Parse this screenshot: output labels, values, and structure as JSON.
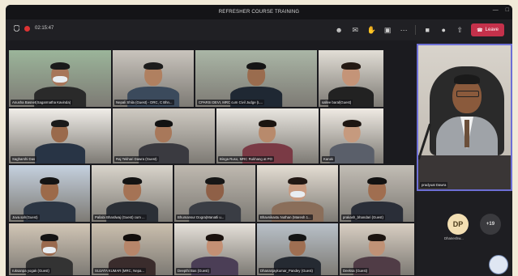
{
  "window": {
    "title": "REFRESHER COURSE TRAINING"
  },
  "toolbar": {
    "timer": "02:15:47",
    "leave_label": "Leave"
  },
  "tiles": [
    {
      "name": "Anusha Basnet(Sagarmatha Kavinda)"
    },
    {
      "name": "Nepali Shila (Guest) - DRC, C Bhn..."
    },
    {
      "name": "CPARSI DEVI, MRC cum Civil Judge (L..."
    },
    {
      "name": "sallee baral(Guest)"
    },
    {
      "name": "Sagharshi Das"
    },
    {
      "name": "Raj Tekhari Dawra (Guest)"
    },
    {
      "name": "Binga Ruso, MRC Rukhang at PO"
    },
    {
      "name": "Karuki"
    },
    {
      "name": "Juva.sah(Guest)"
    },
    {
      "name": "Pallabi Bhardwaj (Guest) cum ..."
    },
    {
      "name": "Bhumansur Dogra(Manatli u..."
    },
    {
      "name": "Bhavnikastu Nuthan (Maresh 1..."
    },
    {
      "name": "prakash_bhandari (Guest)"
    },
    {
      "name": "ruksanpa yogak (Guest)"
    },
    {
      "name": "SUJATA KUMAR (MRC, Nepa..."
    },
    {
      "name": "Deepthi Bas (Guest)"
    },
    {
      "name": "Dhananjaykumar_Pandey (Guest)"
    },
    {
      "name": "Deeksa (Guest)"
    }
  ],
  "spotlight": {
    "name": "pradyuat Dawra"
  },
  "participants": [
    {
      "initials": "DP",
      "name": "Dhaneshw..."
    },
    {
      "initials": "+19",
      "name": ""
    }
  ],
  "colors": {
    "leave": "#c4314b",
    "spotlight_border": "#6d6fd6"
  }
}
